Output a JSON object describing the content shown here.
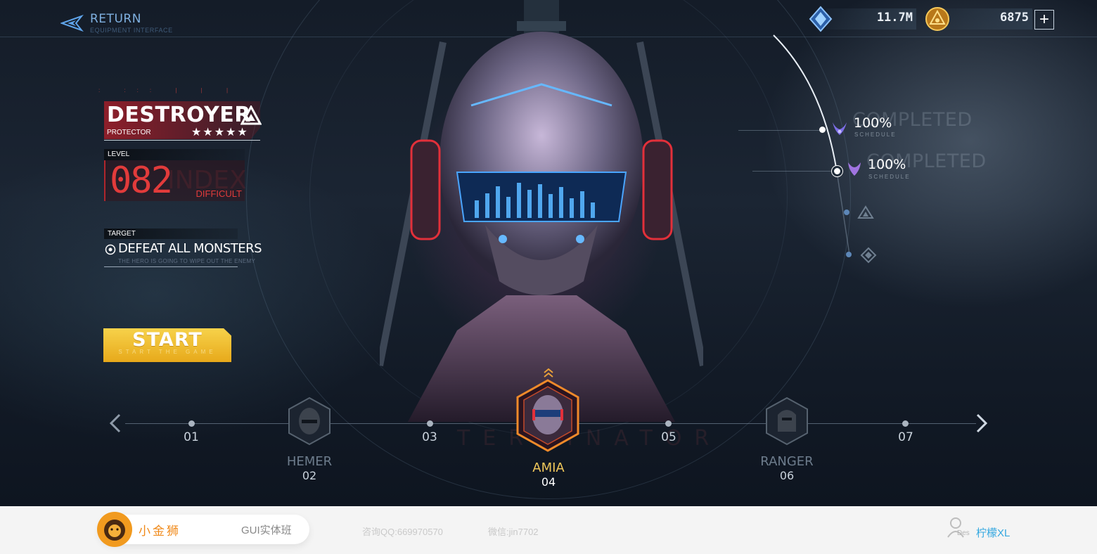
{
  "header": {
    "return_label": "RETURN",
    "return_sub": "EQUIPMENT INTERFACE",
    "gems": "11.7M",
    "coins": "6875",
    "plus": "+"
  },
  "hero": {
    "name": "DESTROYER",
    "class": "PROTECTOR",
    "stars": "★★★★★",
    "rating": 5,
    "level_label": "LEVEL",
    "level": "082",
    "level_ghost": "INDEX",
    "difficulty": "DIFFICULT",
    "target_label": "TARGET",
    "target": "DEFEAT ALL MONSTERS",
    "target_sub": "THE HERO IS GOING TO WIPE OUT THE ENEMY"
  },
  "start": {
    "label": "START",
    "sub": "START THE GAME"
  },
  "progress": [
    {
      "percent": "100%",
      "schedule": "SCHEDULE",
      "ghost": "COMPLETED",
      "icon": "demon-horns-icon"
    },
    {
      "percent": "100%",
      "schedule": "SCHEDULE",
      "ghost": "COMPLETED",
      "icon": "horned-helmet-icon"
    },
    {
      "icon": "triangle-emblem-icon"
    },
    {
      "icon": "diamond-emblem-icon"
    }
  ],
  "carousel": {
    "watermark": "TERMINATOR",
    "nodes": [
      "01",
      "03",
      "05",
      "07"
    ],
    "heroes": [
      {
        "name": "HEMER",
        "id": "02",
        "active": false
      },
      {
        "name": "AMIA",
        "id": "04",
        "active": true
      },
      {
        "name": "RANGER",
        "id": "06",
        "active": false
      }
    ]
  },
  "footer": {
    "brand": "小金狮",
    "course": "GUI实体班",
    "qq": "咨询QQ:669970570",
    "wechat": "微信:jin7702",
    "user_tag": "Des",
    "user_name": "柠檬XL"
  },
  "colors": {
    "accent_red": "#e23b3b",
    "accent_gold": "#f0c75a",
    "accent_blue": "#7fb0e0",
    "footer_orange": "#f08a1a",
    "footer_blue": "#35a8e0"
  }
}
